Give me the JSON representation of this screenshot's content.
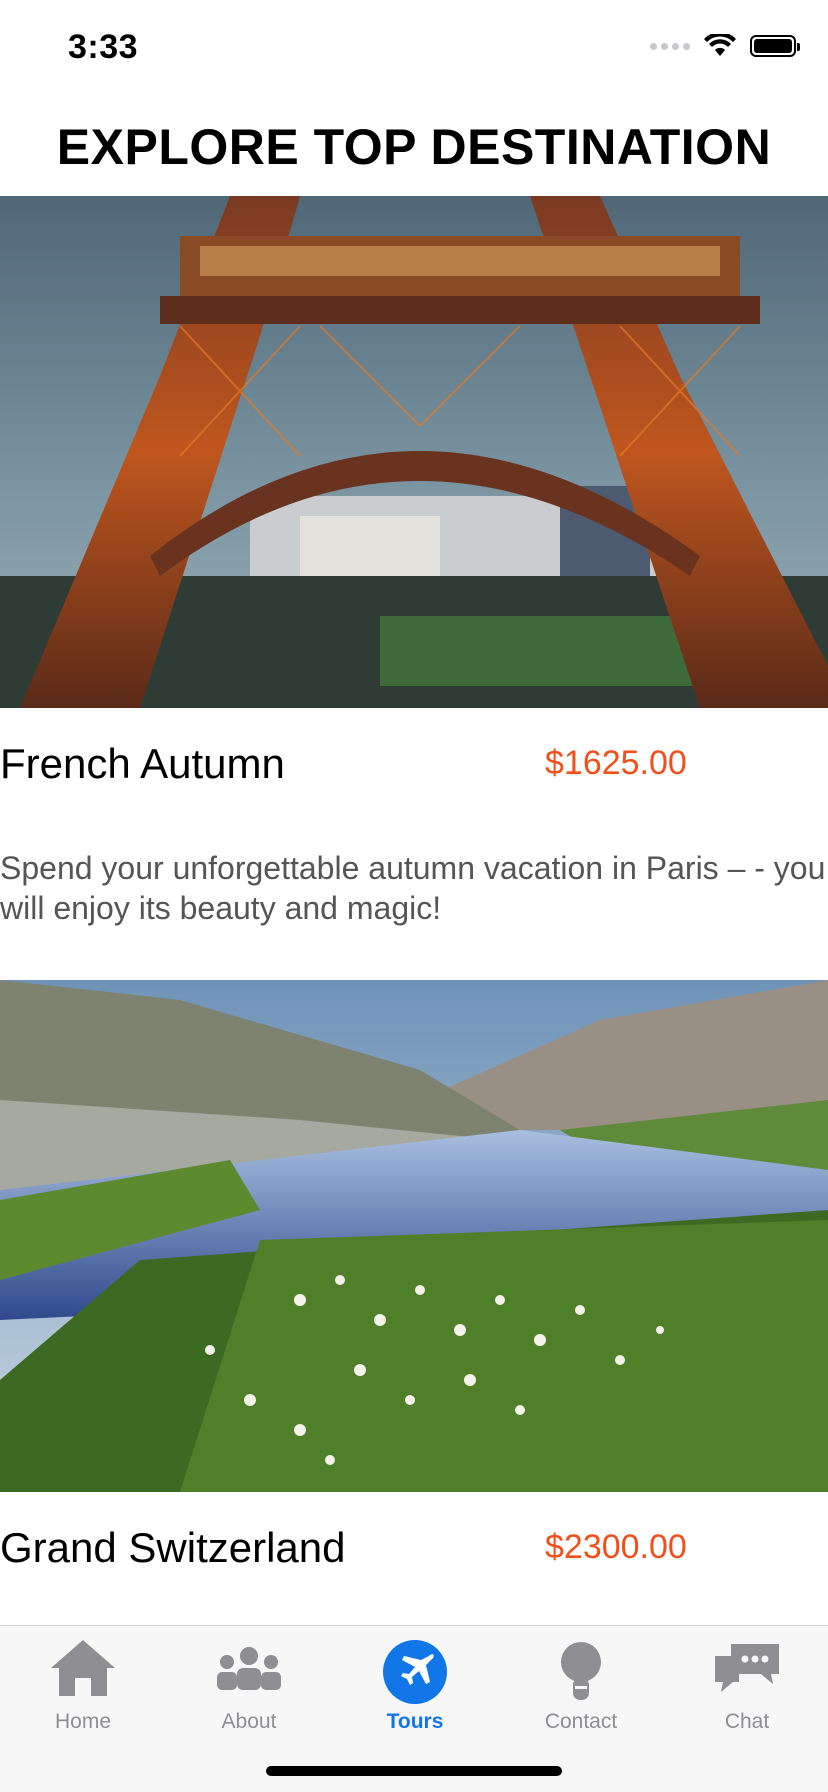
{
  "status_bar": {
    "time": "3:33"
  },
  "header": {
    "title": "EXPLORE TOP DESTINATION"
  },
  "tours": [
    {
      "name": "French Autumn",
      "price": "$1625.00",
      "description": "Spend your unforgettable autumn vacation in Paris – - you will enjoy its beauty and magic!",
      "image": "eiffel-tower-photo"
    },
    {
      "name": "Grand Switzerland",
      "price": "$2300.00",
      "image": "swiss-alps-meadow-photo"
    }
  ],
  "tab_bar": {
    "items": [
      {
        "label": "Home",
        "icon": "home-icon"
      },
      {
        "label": "About",
        "icon": "group-icon"
      },
      {
        "label": "Tours",
        "icon": "airplane-icon",
        "active": true
      },
      {
        "label": "Contact",
        "icon": "headset-icon"
      },
      {
        "label": "Chat",
        "icon": "chat-bubbles-icon"
      }
    ]
  },
  "colors": {
    "price": "#f2501a",
    "active_tab": "#1176e8",
    "inactive_tab": "#8e8e93"
  }
}
